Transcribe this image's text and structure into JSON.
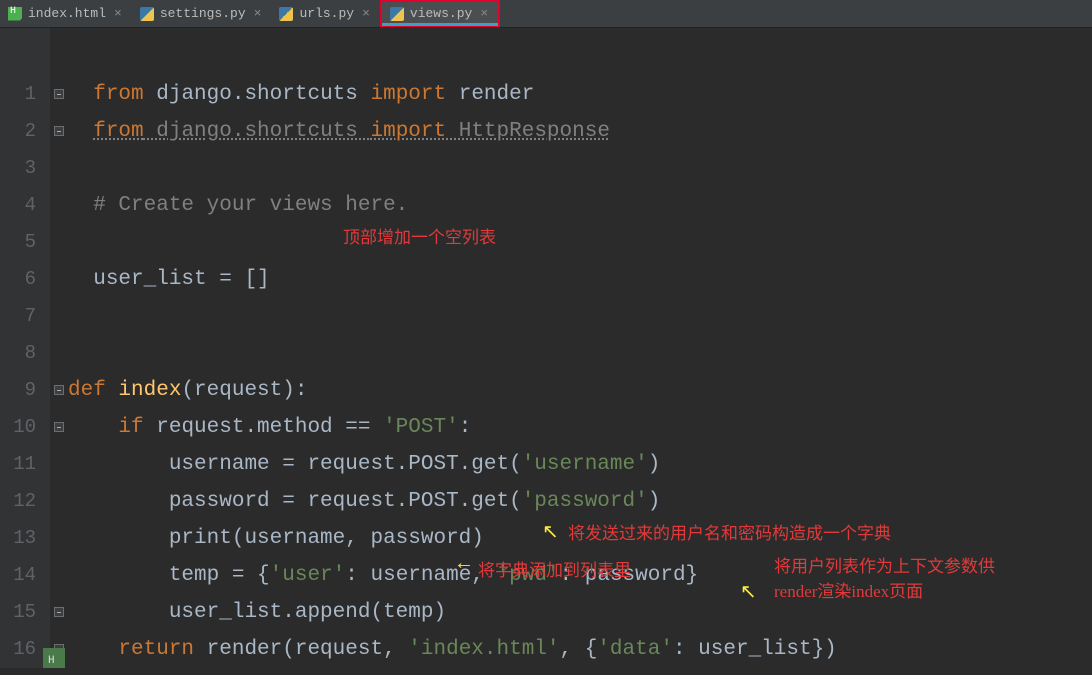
{
  "tabs": [
    {
      "label": "index.html",
      "kind": "html"
    },
    {
      "label": "settings.py",
      "kind": "py"
    },
    {
      "label": "urls.py",
      "kind": "py"
    },
    {
      "label": "views.py",
      "kind": "py",
      "active": true
    }
  ],
  "line_numbers": [
    "1",
    "2",
    "3",
    "4",
    "5",
    "6",
    "7",
    "8",
    "9",
    "10",
    "11",
    "12",
    "13",
    "14",
    "15",
    "16"
  ],
  "code": {
    "l1": {
      "kw1": "from",
      "mod": " django.shortcuts ",
      "kw2": "import",
      "tgt": " render"
    },
    "l2": {
      "kw1": "from",
      "mod": " django.shortcuts ",
      "kw2": "import",
      "tgt": " HttpResponse"
    },
    "l4": "# Create your views here.",
    "l6a": "user_list = [",
    "l6b": "]",
    "l9": {
      "kw": "def ",
      "name": "index",
      "args": "(request):"
    },
    "l10": {
      "ind": "    ",
      "kw": "if ",
      "expr": "request.method == ",
      "str": "'POST'",
      "end": ":"
    },
    "l11": {
      "ind": "        ",
      "lhs": "username = request.POST.get(",
      "str": "'username'",
      "end": ")"
    },
    "l12": {
      "ind": "        ",
      "lhs": "password = request.POST.get(",
      "str": "'password'",
      "end": ")"
    },
    "l13": {
      "ind": "        ",
      "fn": "print",
      "args": "(username, password)"
    },
    "l14": {
      "ind": "        ",
      "a": "temp = {",
      "s1": "'user'",
      "b": ": username, ",
      "s2": "'pwd'",
      "c": ": password}"
    },
    "l15": {
      "ind": "        ",
      "expr": "user_list.append(temp)"
    },
    "l16": {
      "ind": "    ",
      "kw": "return ",
      "a": "render(request, ",
      "s1": "'index.html'",
      "b": ", {",
      "s2": "'data'",
      "c": ": user_list})"
    }
  },
  "annotations": {
    "a1": "顶部增加一个空列表",
    "a2": "将发送过来的用户名和密码构造成一个字典",
    "a3": "将字典添加到列表里",
    "a4a": "将用户列表作为上下文参数供",
    "a4b": "render渲染index页面"
  }
}
